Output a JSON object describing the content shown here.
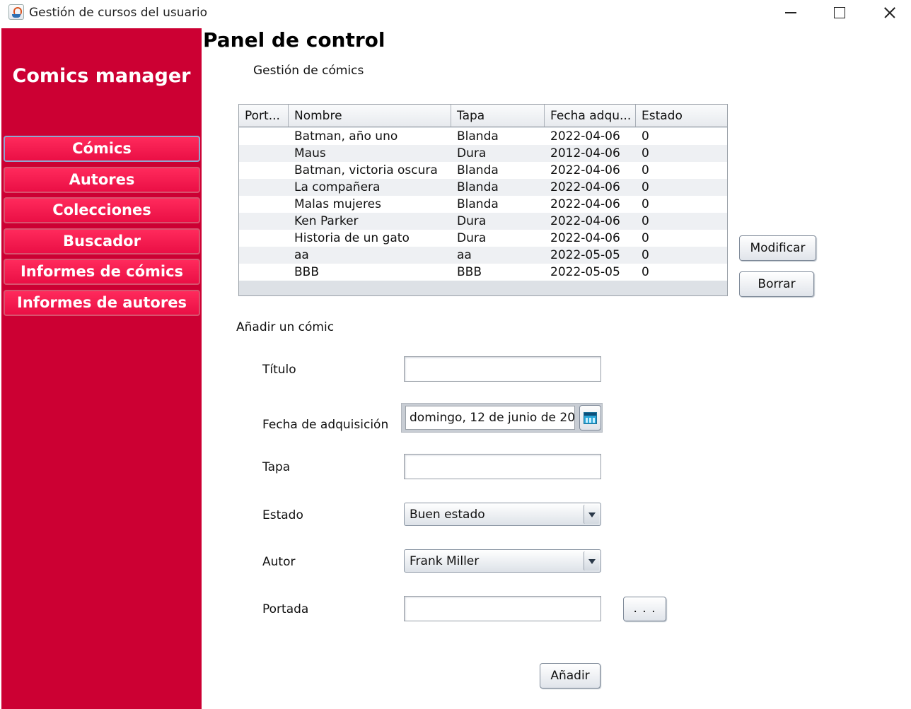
{
  "window": {
    "title": "Gestión de cursos del usuario"
  },
  "sidebar": {
    "brand": "Comics manager",
    "items": [
      {
        "label": "Cómics"
      },
      {
        "label": "Autores"
      },
      {
        "label": "Colecciones"
      },
      {
        "label": "Buscador"
      },
      {
        "label": "Informes de cómics"
      },
      {
        "label": "Informes de autores"
      }
    ]
  },
  "main": {
    "title": "Panel de control",
    "section_manage": "Gestión de cómics",
    "table": {
      "columns": [
        "Port...",
        "Nombre",
        "Tapa",
        "Fecha adqu...",
        "Estado"
      ],
      "rows": [
        [
          "",
          "Batman, año uno",
          "Blanda",
          "2022-04-06",
          "0"
        ],
        [
          "",
          "Maus",
          "Dura",
          "2012-04-06",
          "0"
        ],
        [
          "",
          "Batman, victoria oscura",
          "Blanda",
          "2022-04-06",
          "0"
        ],
        [
          "",
          "La compañera",
          "Blanda",
          "2022-04-06",
          "0"
        ],
        [
          "",
          "Malas mujeres",
          "Blanda",
          "2022-04-06",
          "0"
        ],
        [
          "",
          "Ken Parker",
          "Dura",
          "2022-04-06",
          "0"
        ],
        [
          "",
          "Historia de un gato",
          "Dura",
          "2022-04-06",
          "0"
        ],
        [
          "",
          "aa",
          "aa",
          "2022-05-05",
          "0"
        ],
        [
          "",
          "BBB",
          "BBB",
          "2022-05-05",
          "0"
        ]
      ]
    },
    "buttons": {
      "modify": "Modificar",
      "delete": "Borrar"
    },
    "section_add": "Añadir un cómic",
    "form": {
      "title_label": "Título",
      "title_value": "",
      "date_label": "Fecha de adquisición",
      "date_value": "domingo, 12 de junio de 202",
      "cover_label": "Tapa",
      "cover_value": "",
      "state_label": "Estado",
      "state_value": "Buen estado",
      "author_label": "Autor",
      "author_value": "Frank Miller",
      "portada_label": "Portada",
      "portada_value": "",
      "browse_label": ". . .",
      "add_label": "Añadir"
    }
  }
}
